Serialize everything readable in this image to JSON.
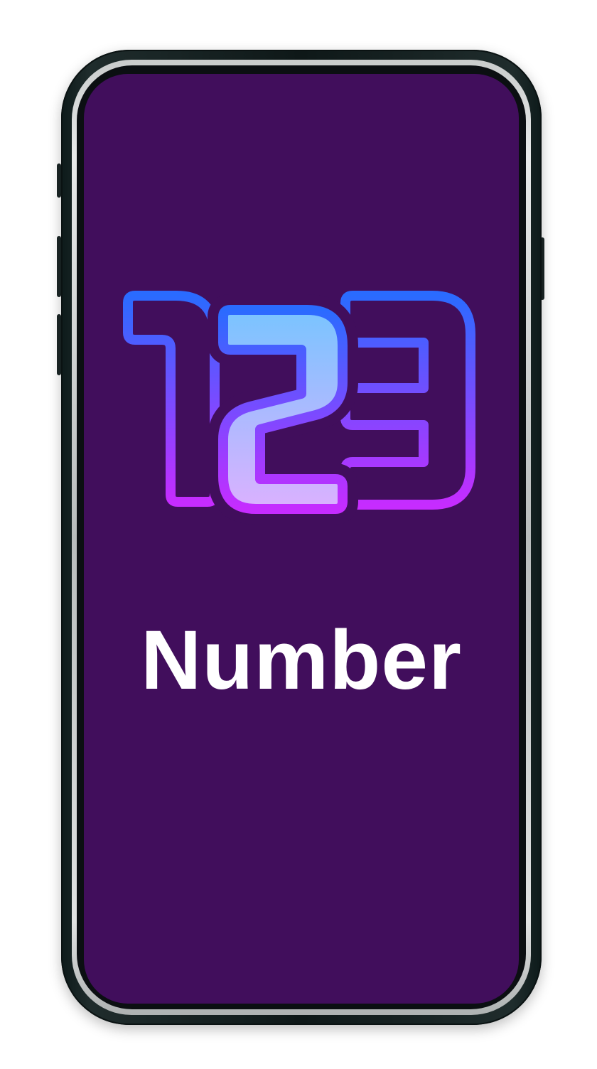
{
  "app": {
    "title": "Number"
  },
  "logo": {
    "icon": "numbers-123-icon",
    "colors": {
      "outline_top": "#2a6bff",
      "outline_bottom": "#c62cff",
      "fill_top": "#79c4ff",
      "fill_bottom": "#dbb1ff"
    }
  },
  "theme": {
    "screen_background": "#410e5c",
    "title_color": "#ffffff"
  }
}
